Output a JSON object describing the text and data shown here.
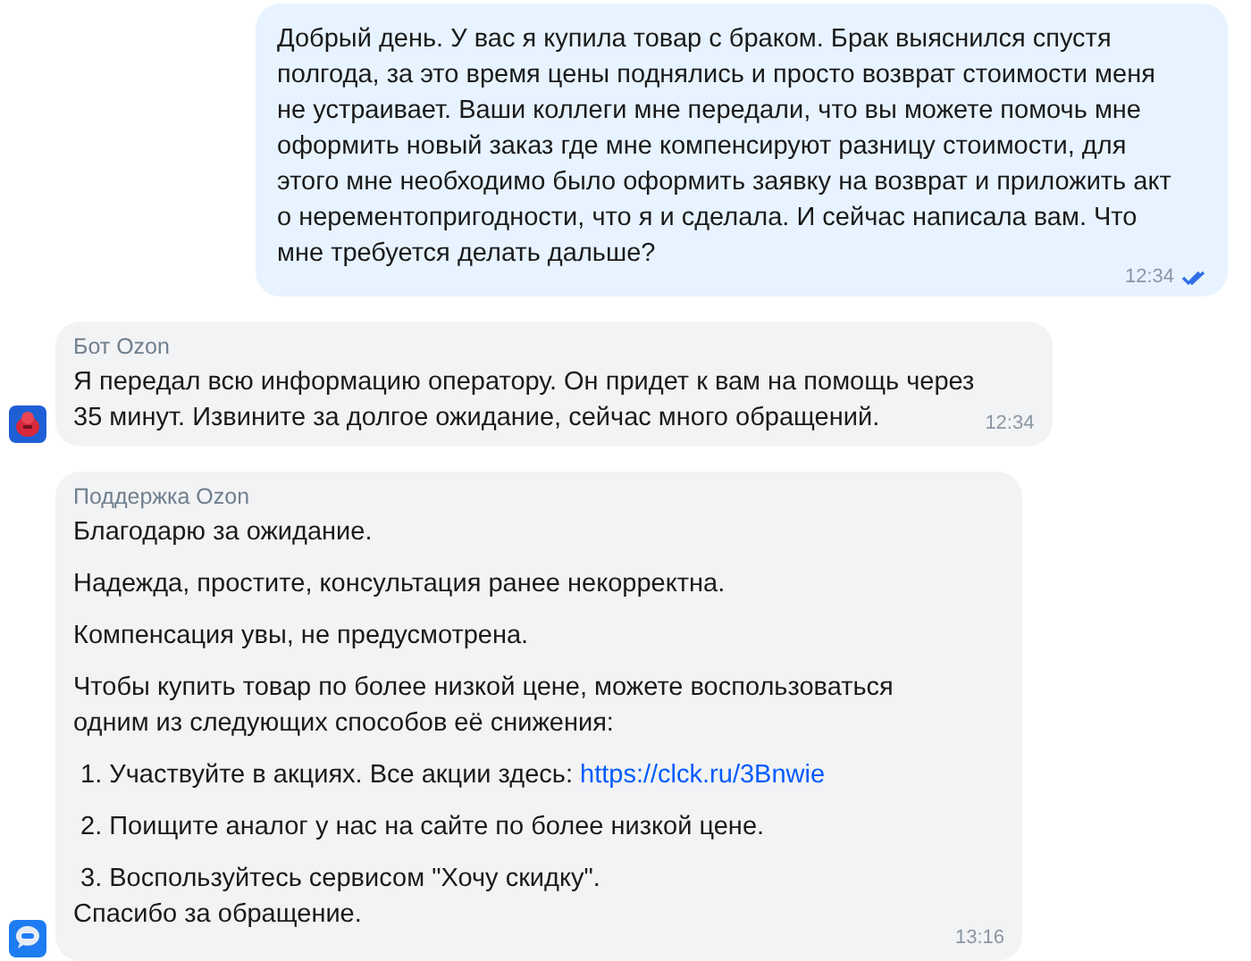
{
  "messages": [
    {
      "kind": "outgoing",
      "lines": [
        "Добрый день. У вас я купила товар с браком. Брак выяснился спустя",
        "полгода, за это время цены поднялись и просто возврат стоимости меня",
        "не устраивает. Ваши коллеги мне передали, что вы можете помочь мне",
        "оформить новый заказ где мне компенсируют разницу стоимости, для",
        "этого мне необходимо было оформить заявку на возврат и приложить акт",
        "о нерементопригодности, что я и сделала. И сейчас написала вам. Что",
        "мне требуется делать дальше?"
      ],
      "time": "12:34",
      "read": true
    },
    {
      "kind": "bot",
      "sender": "Бот Ozon",
      "lines": [
        "Я передал всю информацию оператору. Он придет к вам на помощь через",
        "35 минут. Извините за долгое ожидание, сейчас много обращений."
      ],
      "time": "12:34"
    },
    {
      "kind": "support",
      "sender": "Поддержка Ozon",
      "blocks": [
        {
          "items": [
            {
              "kind": "text",
              "lines": [
                "Благодарю за ожидание."
              ]
            }
          ]
        },
        {
          "items": [
            {
              "kind": "text",
              "lines": [
                "Надежда, простите, консультация ранее некорректна."
              ]
            }
          ]
        },
        {
          "items": [
            {
              "kind": "text",
              "lines": [
                "Компенсация увы, не предусмотрена."
              ]
            }
          ]
        },
        {
          "items": [
            {
              "kind": "text",
              "lines": [
                "Чтобы купить товар по более низкой цене, можете воспользоваться",
                "одним из следующих способов её снижения:"
              ]
            }
          ]
        },
        {
          "items": [
            {
              "kind": "list_item",
              "lines": [
                "1. Участвуйте в акциях. Все акции здесь:"
              ],
              "link": "https://clck.ru/3Bnwie"
            }
          ]
        },
        {
          "items": [
            {
              "kind": "list_item",
              "lines": [
                "2. Поищите аналог у нас на сайте по более низкой цене."
              ]
            }
          ]
        },
        {
          "items": [
            {
              "kind": "list_item",
              "lines": [
                "3. Воспользуйтесь сервисом \"Хочу скидку\"."
              ]
            },
            {
              "kind": "text",
              "lines": [
                "Спасибо за обращение."
              ]
            }
          ]
        }
      ],
      "time": "13:16"
    }
  ]
}
